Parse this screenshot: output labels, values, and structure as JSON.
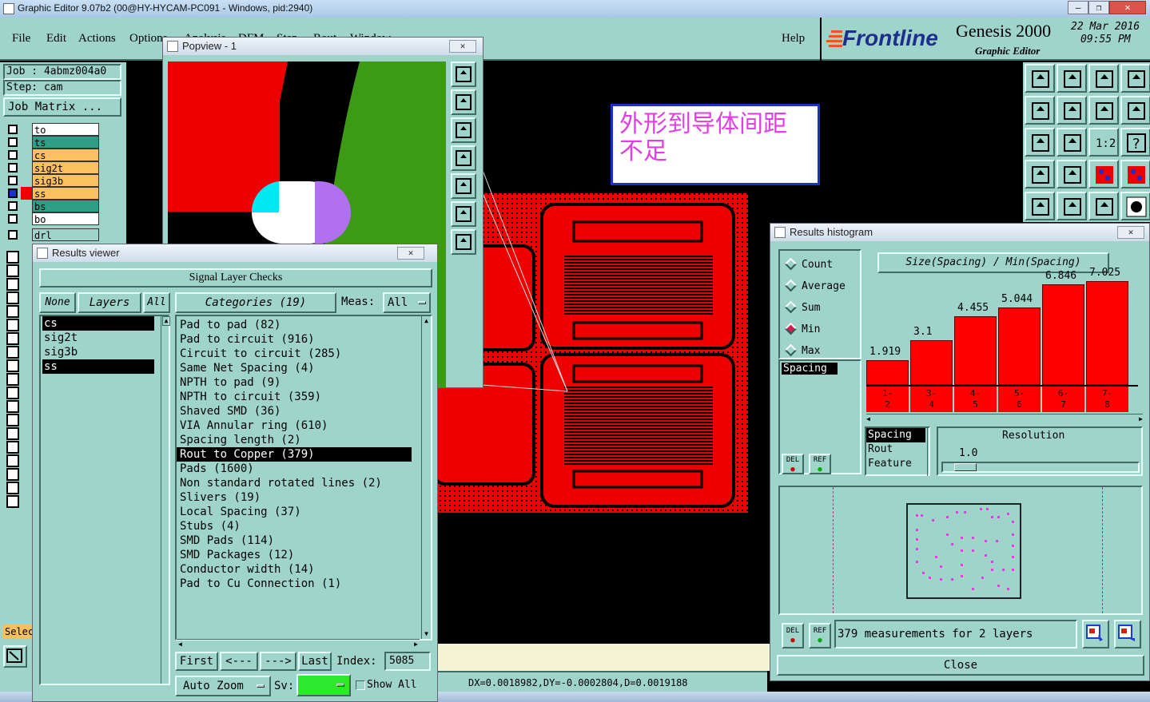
{
  "app": {
    "window_title": "Graphic Editor 9.07b2 (00@HY-HYCAM-PC091 - Windows, pid:2940)",
    "menu": [
      "File",
      "Edit",
      "Actions",
      "Options",
      "Analysis",
      "DFM",
      "Step",
      "Rout",
      "Window"
    ],
    "help": "Help",
    "brand": "Frontline",
    "product": "Genesis 2000",
    "subtitle": "Graphic Editor",
    "date": "22 Mar 2016",
    "time": "09:55 PM"
  },
  "job": {
    "job_label": "Job : 4abmz004a0",
    "step_label": "Step: cam",
    "matrix_button": "Job Matrix ..."
  },
  "layers": [
    {
      "name": "to",
      "color": "#ffffff"
    },
    {
      "name": "ts",
      "color": "#2e9f86"
    },
    {
      "name": "cs",
      "color": "#fbc062"
    },
    {
      "name": "sig2t",
      "color": "#fbc062"
    },
    {
      "name": "sig3b",
      "color": "#fbc062"
    },
    {
      "name": "ss",
      "color": "#fbc062"
    },
    {
      "name": "bs",
      "color": "#2e9f86"
    },
    {
      "name": "bo",
      "color": "#ffffff"
    },
    {
      "name": "drl",
      "color": "#9ed4c9"
    }
  ],
  "left_bottom": {
    "sel_label": "Selec"
  },
  "canvas": {
    "annotation_line1": "外形到导体间距",
    "annotation_line2": "不足",
    "status": "DX=0.0018982,DY=-0.0002804,D=0.0019188"
  },
  "popview": {
    "title": "Popview - 1",
    "close": "✕"
  },
  "results_viewer": {
    "title": "Results viewer",
    "header": "Signal Layer Checks",
    "none_btn": "None",
    "layers_btn": "Layers",
    "all_btn": "All",
    "categories_btn": "Categories (19)",
    "meas_label": "Meas:",
    "meas_value": "All",
    "layer_list": [
      {
        "name": "cs",
        "selected": true
      },
      {
        "name": "sig2t",
        "selected": false
      },
      {
        "name": "sig3b",
        "selected": false
      },
      {
        "name": "ss",
        "selected": true
      }
    ],
    "categories": [
      "Pad to pad (82)",
      "Pad to circuit (916)",
      "Circuit to circuit (285)",
      "Same Net Spacing (4)",
      "NPTH to pad (9)",
      "NPTH to circuit (359)",
      "Shaved SMD (36)",
      "VIA Annular ring (610)",
      "Spacing length (2)",
      "Rout to Copper (379)",
      "Pads (1600)",
      "Non standard rotated lines (2)",
      "Slivers (19)",
      "Local Spacing (37)",
      "Stubs (4)",
      "SMD Pads (114)",
      "SMD Packages (12)",
      "Conductor width (14)",
      "Pad to Cu Connection (1)"
    ],
    "selected_category_index": 9,
    "nav": {
      "first": "First",
      "prev": "<---",
      "next": "--->",
      "last": "Last",
      "index_label": "Index:",
      "index_value": "5085"
    },
    "auto_zoom": "Auto Zoom",
    "sv_label": "Sv:",
    "show_all": "Show All"
  },
  "histogram": {
    "title": "Results histogram",
    "radios": [
      {
        "label": "Count",
        "on": false
      },
      {
        "label": "Average",
        "on": false
      },
      {
        "label": "Sum",
        "on": false
      },
      {
        "label": "Min",
        "on": true
      },
      {
        "label": "Max",
        "on": false
      }
    ],
    "spacing_item": "Spacing",
    "chart_title": "Size(Spacing) / Min(Spacing)",
    "bars": [
      {
        "value": "1.919",
        "range": "1-2",
        "level": 0.11
      },
      {
        "value": "3.1",
        "range": "3-4",
        "level": 0.3
      },
      {
        "value": "4.455",
        "range": "4-5",
        "level": 0.53
      },
      {
        "value": "5.044",
        "range": "5-6",
        "level": 0.61
      },
      {
        "value": "6.846",
        "range": "6-7",
        "level": 0.83
      },
      {
        "value": "7.025",
        "range": "7-8",
        "level": 0.86
      }
    ],
    "type_list": [
      "Spacing",
      "Rout",
      "Feature"
    ],
    "resolution_label": "Resolution",
    "resolution_value": "1.0",
    "del": "DEL",
    "ref": "REF",
    "measurements": "379 measurements for 2 layers",
    "close": "Close"
  }
}
